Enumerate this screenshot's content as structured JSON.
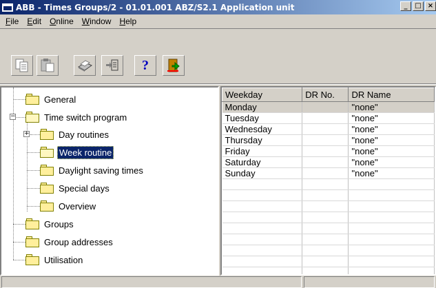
{
  "window": {
    "title": "ABB - Times Groups/2 - 01.01.001 ABZ/S2.1 Application unit",
    "minimize": "_",
    "maximize": "□",
    "close": "×"
  },
  "menu": [
    {
      "label": "File",
      "u": "F",
      "rest": "ile"
    },
    {
      "label": "Edit",
      "u": "E",
      "rest": "dit"
    },
    {
      "label": "Online",
      "u": "O",
      "rest": "nline"
    },
    {
      "label": "Window",
      "u": "W",
      "rest": "indow"
    },
    {
      "label": "Help",
      "u": "H",
      "rest": "elp"
    }
  ],
  "toolbar": {
    "buttons": [
      {
        "name": "copy-icon"
      },
      {
        "name": "paste-icon"
      },
      {
        "name": "print-icon"
      },
      {
        "name": "download-icon"
      },
      {
        "name": "help-icon",
        "glyph": "?"
      },
      {
        "name": "exit-icon"
      }
    ]
  },
  "tree": {
    "items": [
      {
        "label": "General"
      },
      {
        "label": "Time switch program",
        "expander": "−"
      },
      {
        "label": "Day routines",
        "expander": "+"
      },
      {
        "label": "Week routine",
        "selected": true
      },
      {
        "label": "Daylight saving times"
      },
      {
        "label": "Special days"
      },
      {
        "label": "Overview"
      },
      {
        "label": "Groups"
      },
      {
        "label": "Group addresses"
      },
      {
        "label": "Utilisation"
      }
    ]
  },
  "grid": {
    "columns": [
      "Weekday",
      "DR No.",
      "DR Name"
    ],
    "rows": [
      [
        "Monday",
        "",
        "\"none\""
      ],
      [
        "Tuesday",
        "",
        "\"none\""
      ],
      [
        "Wednesday",
        "",
        "\"none\""
      ],
      [
        "Thursday",
        "",
        "\"none\""
      ],
      [
        "Friday",
        "",
        "\"none\""
      ],
      [
        "Saturday",
        "",
        "\"none\""
      ],
      [
        "Sunday",
        "",
        "\"none\""
      ]
    ],
    "selected_row": 0
  }
}
